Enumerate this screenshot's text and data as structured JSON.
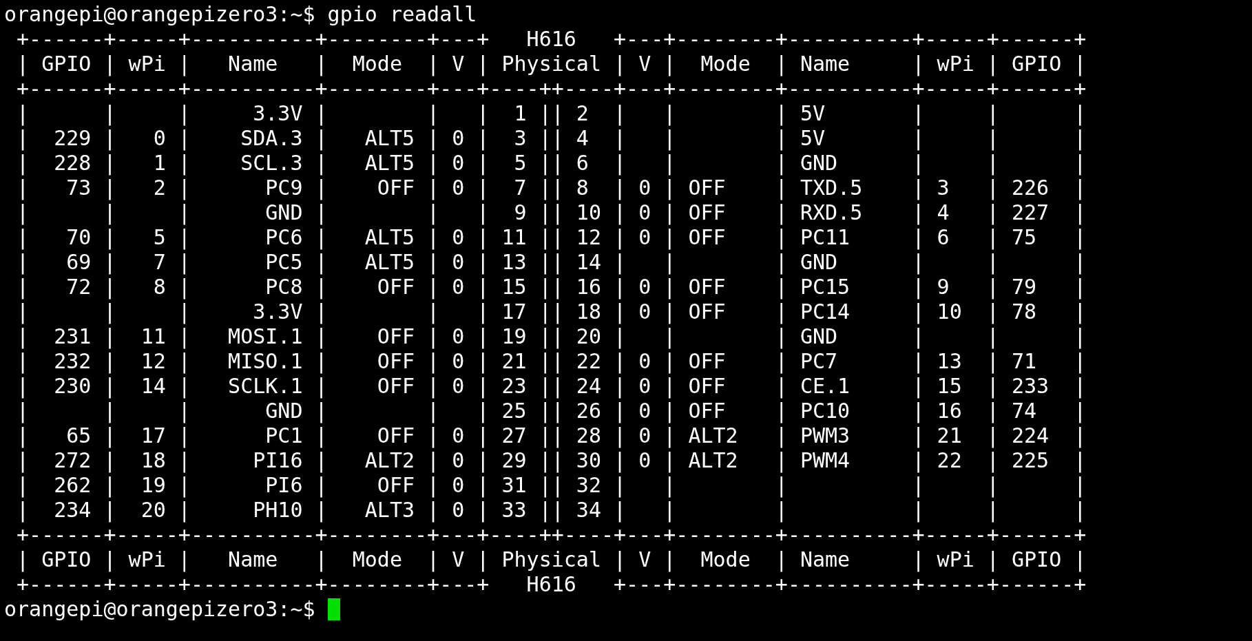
{
  "lines": [
    "orangepi@orangepizero3:~$ gpio readall",
    " +------+-----+----------+--------+---+   H616   +---+--------+----------+-----+------+",
    " | GPIO | wPi |   Name   |  Mode  | V | Physical | V |  Mode  | Name     | wPi | GPIO |",
    " +------+-----+----------+--------+---+----++----+---+--------+----------+-----+------+",
    " |      |     |     3.3V |        |   |  1 || 2  |   |        | 5V       |     |      |",
    " |  229 |   0 |    SDA.3 |   ALT5 | 0 |  3 || 4  |   |        | 5V       |     |      |",
    " |  228 |   1 |    SCL.3 |   ALT5 | 0 |  5 || 6  |   |        | GND      |     |      |",
    " |   73 |   2 |      PC9 |    OFF | 0 |  7 || 8  | 0 | OFF    | TXD.5    | 3   | 226  |",
    " |      |     |      GND |        |   |  9 || 10 | 0 | OFF    | RXD.5    | 4   | 227  |",
    " |   70 |   5 |      PC6 |   ALT5 | 0 | 11 || 12 | 0 | OFF    | PC11     | 6   | 75   |",
    " |   69 |   7 |      PC5 |   ALT5 | 0 | 13 || 14 |   |        | GND      |     |      |",
    " |   72 |   8 |      PC8 |    OFF | 0 | 15 || 16 | 0 | OFF    | PC15     | 9   | 79   |",
    " |      |     |     3.3V |        |   | 17 || 18 | 0 | OFF    | PC14     | 10  | 78   |",
    " |  231 |  11 |   MOSI.1 |    OFF | 0 | 19 || 20 |   |        | GND      |     |      |",
    " |  232 |  12 |   MISO.1 |    OFF | 0 | 21 || 22 | 0 | OFF    | PC7      | 13  | 71   |",
    " |  230 |  14 |   SCLK.1 |    OFF | 0 | 23 || 24 | 0 | OFF    | CE.1     | 15  | 233  |",
    " |      |     |      GND |        |   | 25 || 26 | 0 | OFF    | PC10     | 16  | 74   |",
    " |   65 |  17 |      PC1 |    OFF | 0 | 27 || 28 | 0 | ALT2   | PWM3     | 21  | 224  |",
    " |  272 |  18 |     PI16 |   ALT2 | 0 | 29 || 30 | 0 | ALT2   | PWM4     | 22  | 225  |",
    " |  262 |  19 |      PI6 |    OFF | 0 | 31 || 32 |   |        |          |     |      |",
    " |  234 |  20 |     PH10 |   ALT3 | 0 | 33 || 34 |   |        |          |     |      |",
    " +------+-----+----------+--------+---+----++----+---+--------+----------+-----+------+",
    " | GPIO | wPi |   Name   |  Mode  | V | Physical | V |  Mode  | Name     | wPi | GPIO |",
    " +------+-----+----------+--------+---+   H616   +---+--------+----------+-----+------+"
  ],
  "prompt": {
    "text": "orangepi@orangepizero3:~$",
    "cursor": true
  }
}
